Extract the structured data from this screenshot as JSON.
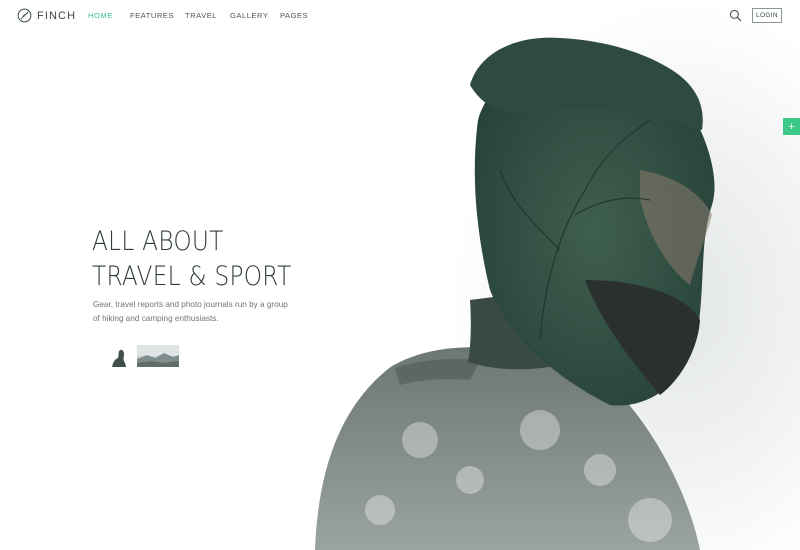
{
  "brand": {
    "name": "FINCH"
  },
  "nav": {
    "items": [
      {
        "label": "HOME",
        "active": true
      },
      {
        "label": "FEATURES",
        "active": false
      },
      {
        "label": "TRAVEL",
        "active": false
      },
      {
        "label": "GALLERY",
        "active": false
      },
      {
        "label": "PAGES",
        "active": false
      }
    ]
  },
  "header": {
    "login_label": "LOGIN",
    "search_icon": "search-icon"
  },
  "side_tab": {
    "label": "+"
  },
  "hero": {
    "title_line1": "ALL ABOUT",
    "title_line2": "TRAVEL & SPORT",
    "subtitle": "Gear, travel reports and photo journals run by a group of hiking and camping enthusiasts."
  },
  "colors": {
    "accent": "#3cc29b",
    "side_tab": "#3cc987",
    "text_dark": "#2f3b3e"
  }
}
